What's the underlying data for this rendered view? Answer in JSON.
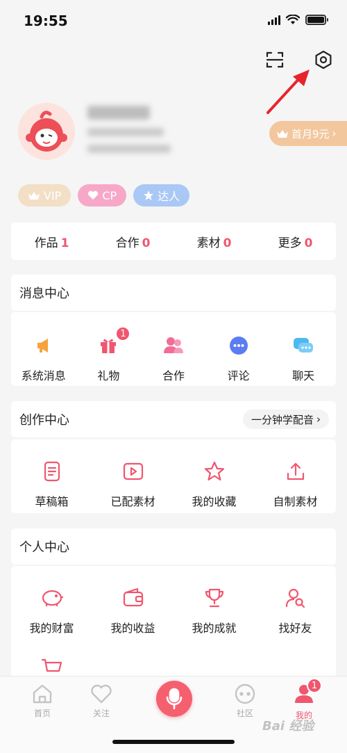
{
  "status": {
    "time": "19:55"
  },
  "top_icons": [
    "scan-icon",
    "settings-icon"
  ],
  "profile": {
    "vip_promo": "首月9元"
  },
  "badges": [
    {
      "label": "VIP",
      "color": "#f2dfc6"
    },
    {
      "label": "CP",
      "color": "#f7a8c8"
    },
    {
      "label": "达人",
      "color": "#a9c8f5"
    }
  ],
  "stats": [
    {
      "label": "作品",
      "value": "1"
    },
    {
      "label": "合作",
      "value": "0"
    },
    {
      "label": "素材",
      "value": "0"
    },
    {
      "label": "更多",
      "value": "0"
    }
  ],
  "message_center": {
    "title": "消息中心",
    "items": [
      {
        "label": "系统消息",
        "icon": "megaphone-icon"
      },
      {
        "label": "礼物",
        "icon": "gift-icon",
        "badge": "1"
      },
      {
        "label": "合作",
        "icon": "users-icon"
      },
      {
        "label": "评论",
        "icon": "comment-icon"
      },
      {
        "label": "聊天",
        "icon": "chat-icon"
      }
    ]
  },
  "creation_center": {
    "title": "创作中心",
    "link": "一分钟学配音",
    "items": [
      {
        "label": "草稿箱",
        "icon": "draft-icon"
      },
      {
        "label": "已配素材",
        "icon": "video-icon"
      },
      {
        "label": "我的收藏",
        "icon": "star-icon"
      },
      {
        "label": "自制素材",
        "icon": "upload-icon"
      }
    ]
  },
  "personal_center": {
    "title": "个人中心",
    "items": [
      {
        "label": "我的财富",
        "icon": "piggy-bank-icon"
      },
      {
        "label": "我的收益",
        "icon": "wallet-icon"
      },
      {
        "label": "我的成就",
        "icon": "trophy-icon"
      },
      {
        "label": "找好友",
        "icon": "find-friend-icon"
      }
    ]
  },
  "tabs": [
    {
      "label": "首页",
      "icon": "home-icon"
    },
    {
      "label": "关注",
      "icon": "heart-icon"
    },
    {
      "label": "社区",
      "icon": "community-icon"
    },
    {
      "label": "我的",
      "icon": "profile-icon",
      "badge": "1",
      "active": true
    }
  ],
  "watermark": "Bai 经验",
  "colors": {
    "accent": "#f0566e",
    "vip_promo": "#f3c79e"
  }
}
